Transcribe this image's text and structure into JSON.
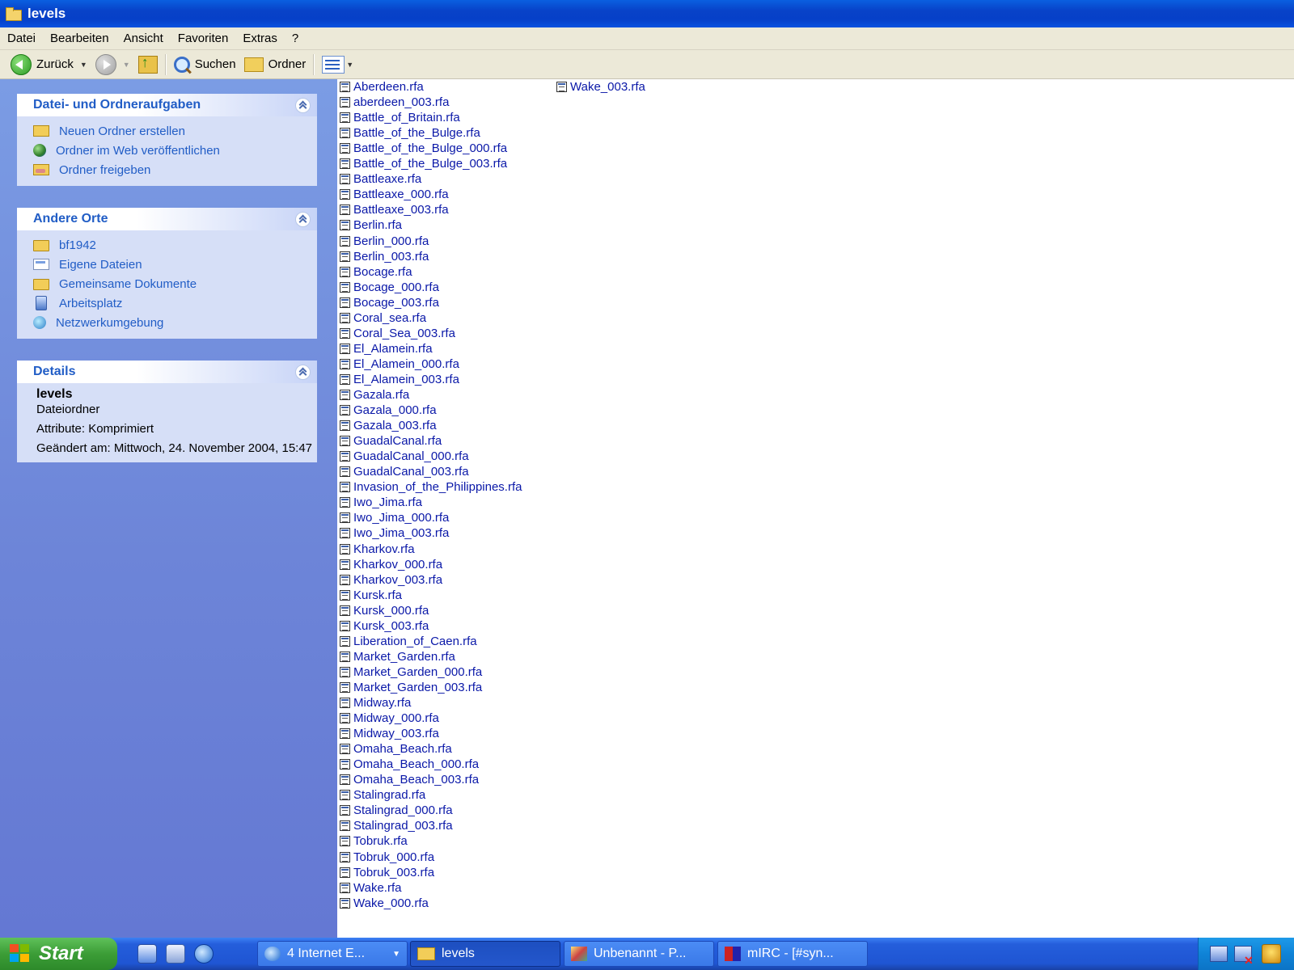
{
  "window": {
    "title": "levels"
  },
  "menu": [
    "Datei",
    "Bearbeiten",
    "Ansicht",
    "Favoriten",
    "Extras",
    "?"
  ],
  "toolbar": {
    "back_label": "Zurück",
    "search_label": "Suchen",
    "folders_label": "Ordner"
  },
  "tasks_panel": {
    "title": "Datei- und Ordneraufgaben",
    "items": [
      {
        "label": "Neuen Ordner erstellen",
        "icon": "new-folder-icon"
      },
      {
        "label": "Ordner im Web veröffentlichen",
        "icon": "publish-web-icon"
      },
      {
        "label": "Ordner freigeben",
        "icon": "share-folder-icon"
      }
    ]
  },
  "places_panel": {
    "title": "Andere Orte",
    "items": [
      {
        "label": "bf1942",
        "icon": "folder-icon"
      },
      {
        "label": "Eigene Dateien",
        "icon": "my-documents-icon"
      },
      {
        "label": "Gemeinsame Dokumente",
        "icon": "folder-icon"
      },
      {
        "label": "Arbeitsplatz",
        "icon": "computer-icon"
      },
      {
        "label": "Netzwerkumgebung",
        "icon": "network-icon"
      }
    ]
  },
  "details_panel": {
    "title": "Details",
    "name": "levels",
    "type": "Dateiordner",
    "attributes": "Attribute: Komprimiert",
    "modified": "Geändert am: Mittwoch, 24. November 2004, 15:47"
  },
  "files": [
    "Aberdeen.rfa",
    "aberdeen_003.rfa",
    "Battle_of_Britain.rfa",
    "Battle_of_the_Bulge.rfa",
    "Battle_of_the_Bulge_000.rfa",
    "Battle_of_the_Bulge_003.rfa",
    "Battleaxe.rfa",
    "Battleaxe_000.rfa",
    "Battleaxe_003.rfa",
    "Berlin.rfa",
    "Berlin_000.rfa",
    "Berlin_003.rfa",
    "Bocage.rfa",
    "Bocage_000.rfa",
    "Bocage_003.rfa",
    "Coral_sea.rfa",
    "Coral_Sea_003.rfa",
    "El_Alamein.rfa",
    "El_Alamein_000.rfa",
    "El_Alamein_003.rfa",
    "Gazala.rfa",
    "Gazala_000.rfa",
    "Gazala_003.rfa",
    "GuadalCanal.rfa",
    "GuadalCanal_000.rfa",
    "GuadalCanal_003.rfa",
    "Invasion_of_the_Philippines.rfa",
    "Iwo_Jima.rfa",
    "Iwo_Jima_000.rfa",
    "Iwo_Jima_003.rfa",
    "Kharkov.rfa",
    "Kharkov_000.rfa",
    "Kharkov_003.rfa",
    "Kursk.rfa",
    "Kursk_000.rfa",
    "Kursk_003.rfa",
    "Liberation_of_Caen.rfa",
    "Market_Garden.rfa",
    "Market_Garden_000.rfa",
    "Market_Garden_003.rfa",
    "Midway.rfa",
    "Midway_000.rfa",
    "Midway_003.rfa",
    "Omaha_Beach.rfa",
    "Omaha_Beach_000.rfa",
    "Omaha_Beach_003.rfa",
    "Stalingrad.rfa",
    "Stalingrad_000.rfa",
    "Stalingrad_003.rfa",
    "Tobruk.rfa",
    "Tobruk_000.rfa",
    "Tobruk_003.rfa",
    "Wake.rfa",
    "Wake_000.rfa",
    "Wake_003.rfa"
  ],
  "taskbar": {
    "start_label": "Start",
    "buttons": [
      {
        "label": "4 Internet E...",
        "active": false
      },
      {
        "label": "levels",
        "active": true
      },
      {
        "label": "Unbenannt - P...",
        "active": false
      },
      {
        "label": "mIRC - [#syn...",
        "active": false
      }
    ]
  }
}
